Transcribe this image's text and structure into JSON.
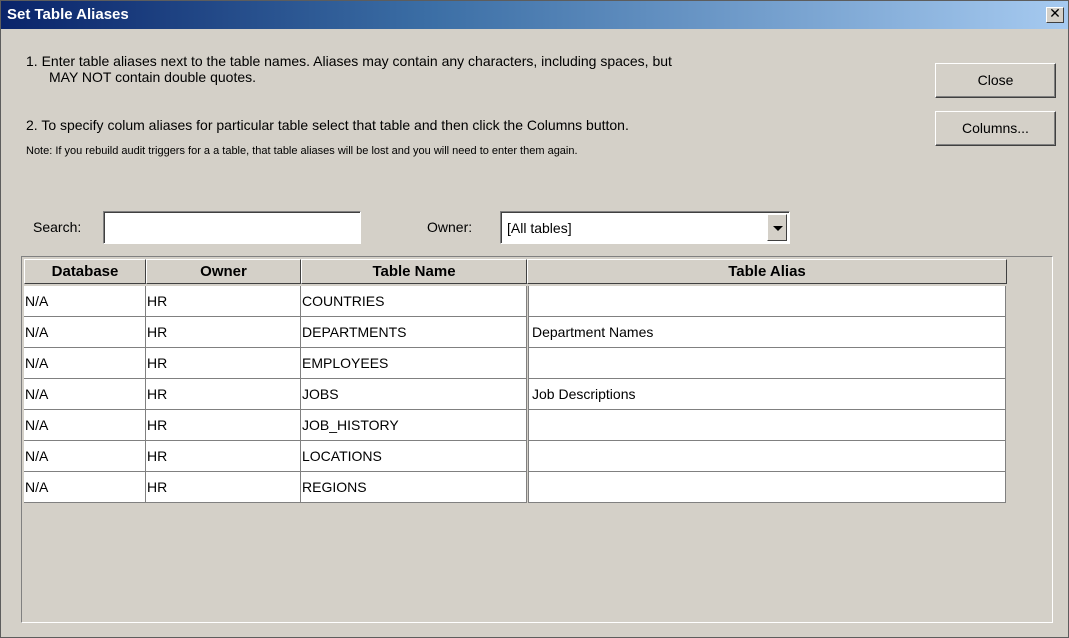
{
  "window": {
    "title": "Set Table Aliases",
    "close_glyph": "✕"
  },
  "instructions": {
    "line1a": "1. Enter table aliases next to the table names. Aliases may contain any characters, including spaces, but",
    "line1b": "MAY NOT contain double quotes.",
    "line2": "2. To specify colum aliases for particular table select that table and then click the Columns button.",
    "note": "Note: If you rebuild audit triggers for a a table, that table aliases will be lost and you will need to enter them again."
  },
  "buttons": {
    "close": "Close",
    "columns": "Columns..."
  },
  "filters": {
    "search_label": "Search:",
    "search_value": "",
    "owner_label": "Owner:",
    "owner_value": "[All tables]"
  },
  "table": {
    "headers": [
      "Database",
      "Owner",
      "Table Name",
      "Table Alias"
    ],
    "rows": [
      [
        "N/A",
        "HR",
        "COUNTRIES",
        ""
      ],
      [
        "N/A",
        "HR",
        "DEPARTMENTS",
        "Department Names"
      ],
      [
        "N/A",
        "HR",
        "EMPLOYEES",
        ""
      ],
      [
        "N/A",
        "HR",
        "JOBS",
        "Job Descriptions"
      ],
      [
        "N/A",
        "HR",
        "JOB_HISTORY",
        ""
      ],
      [
        "N/A",
        "HR",
        "LOCATIONS",
        ""
      ],
      [
        "N/A",
        "HR",
        "REGIONS",
        ""
      ]
    ]
  },
  "colors": {
    "titlebar_start": "#0a246a",
    "titlebar_end": "#a6caf0",
    "face": "#d4d0c8"
  }
}
